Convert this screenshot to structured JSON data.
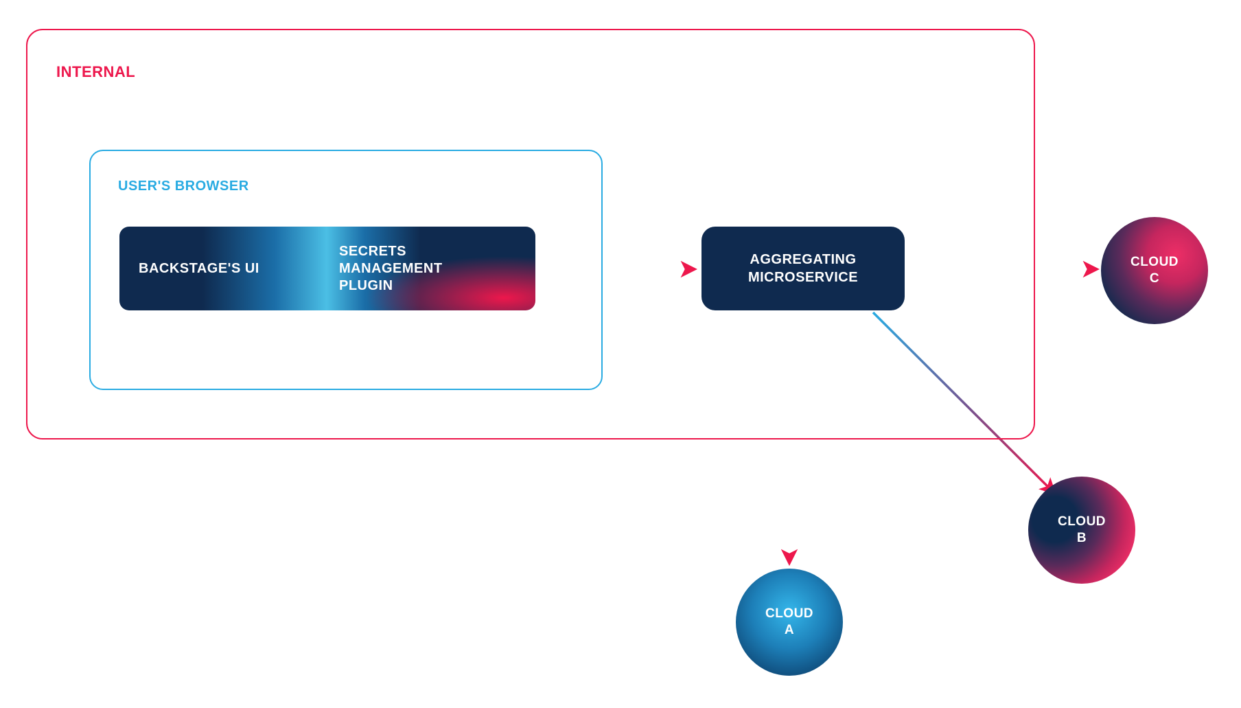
{
  "internal": {
    "label": "INTERNAL"
  },
  "browser": {
    "label": "USER'S BROWSER"
  },
  "backstage": {
    "label": "BACKSTAGE'S UI"
  },
  "secrets": {
    "label": "SECRETS\nMANAGEMENT\nPLUGIN"
  },
  "aggregator": {
    "label": "AGGREGATING\nMICROSERVICE"
  },
  "clouds": {
    "a": "CLOUD\nA",
    "b": "CLOUD\nB",
    "c": "CLOUD\nC"
  },
  "colors": {
    "pink": "#ed174c",
    "cyan": "#29abe2",
    "navy": "#0f2a4f"
  }
}
